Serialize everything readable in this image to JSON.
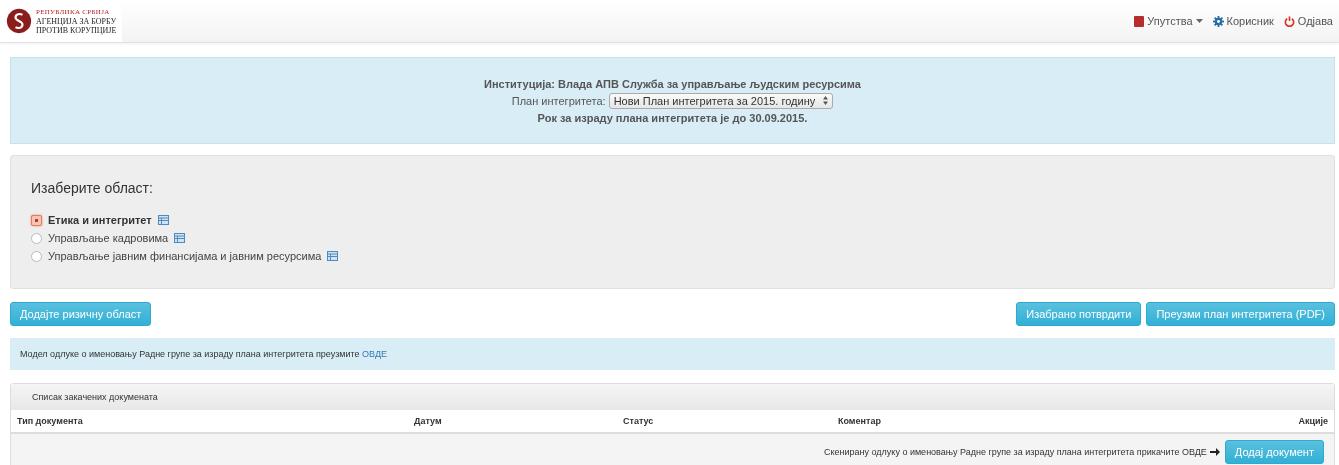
{
  "logo": {
    "lines": [
      "РЕПУБЛИКА СРБИЈА",
      "АГЕНЦИЈА ЗА БОРБУ",
      "ПРОТИВ КОРУПЦИЈЕ"
    ]
  },
  "nav": [
    {
      "kind": "book",
      "label": "Упутства",
      "dropdown": true
    },
    {
      "kind": "gear",
      "label": "Корисник",
      "dropdown": false
    },
    {
      "kind": "power",
      "label": "Одјава",
      "dropdown": false
    }
  ],
  "institution": {
    "label": "Институција:",
    "value": "Влада АПВ Служба за управљање људским ресурсима",
    "plan_label": "План интегритета:",
    "plan_value": "Нови План интегритета за 2015. годину",
    "deadline": "Рок за израду плана интегритета је до 30.09.2015."
  },
  "areas": {
    "title": "Изаберите област:",
    "items": [
      {
        "label": "Етика и интегритет",
        "selected": true
      },
      {
        "label": "Управљање кадровима",
        "selected": false
      },
      {
        "label": "Управљање јавним финансијама и јавним ресурсима",
        "selected": false
      }
    ]
  },
  "buttons_left": [
    "Додајте ризичну област"
  ],
  "buttons_right": [
    "Изабрано потврдити",
    "Преузми план интегритета (PDF)"
  ],
  "notice": {
    "text": "Модел одлуке о именовању Радне групе за израду плана интегритета преузмите",
    "link": "ОВДЕ"
  },
  "documents": {
    "title": "Списак закачених докумената",
    "columns": [
      "Тип документа",
      "Датум",
      "Статус",
      "Коментар",
      "Акције"
    ],
    "footer_text": "Скенирану одлуку о именовању Радне групе за израду плана интегритета прикачите ОВДЕ",
    "add_button": "Додај документ"
  }
}
